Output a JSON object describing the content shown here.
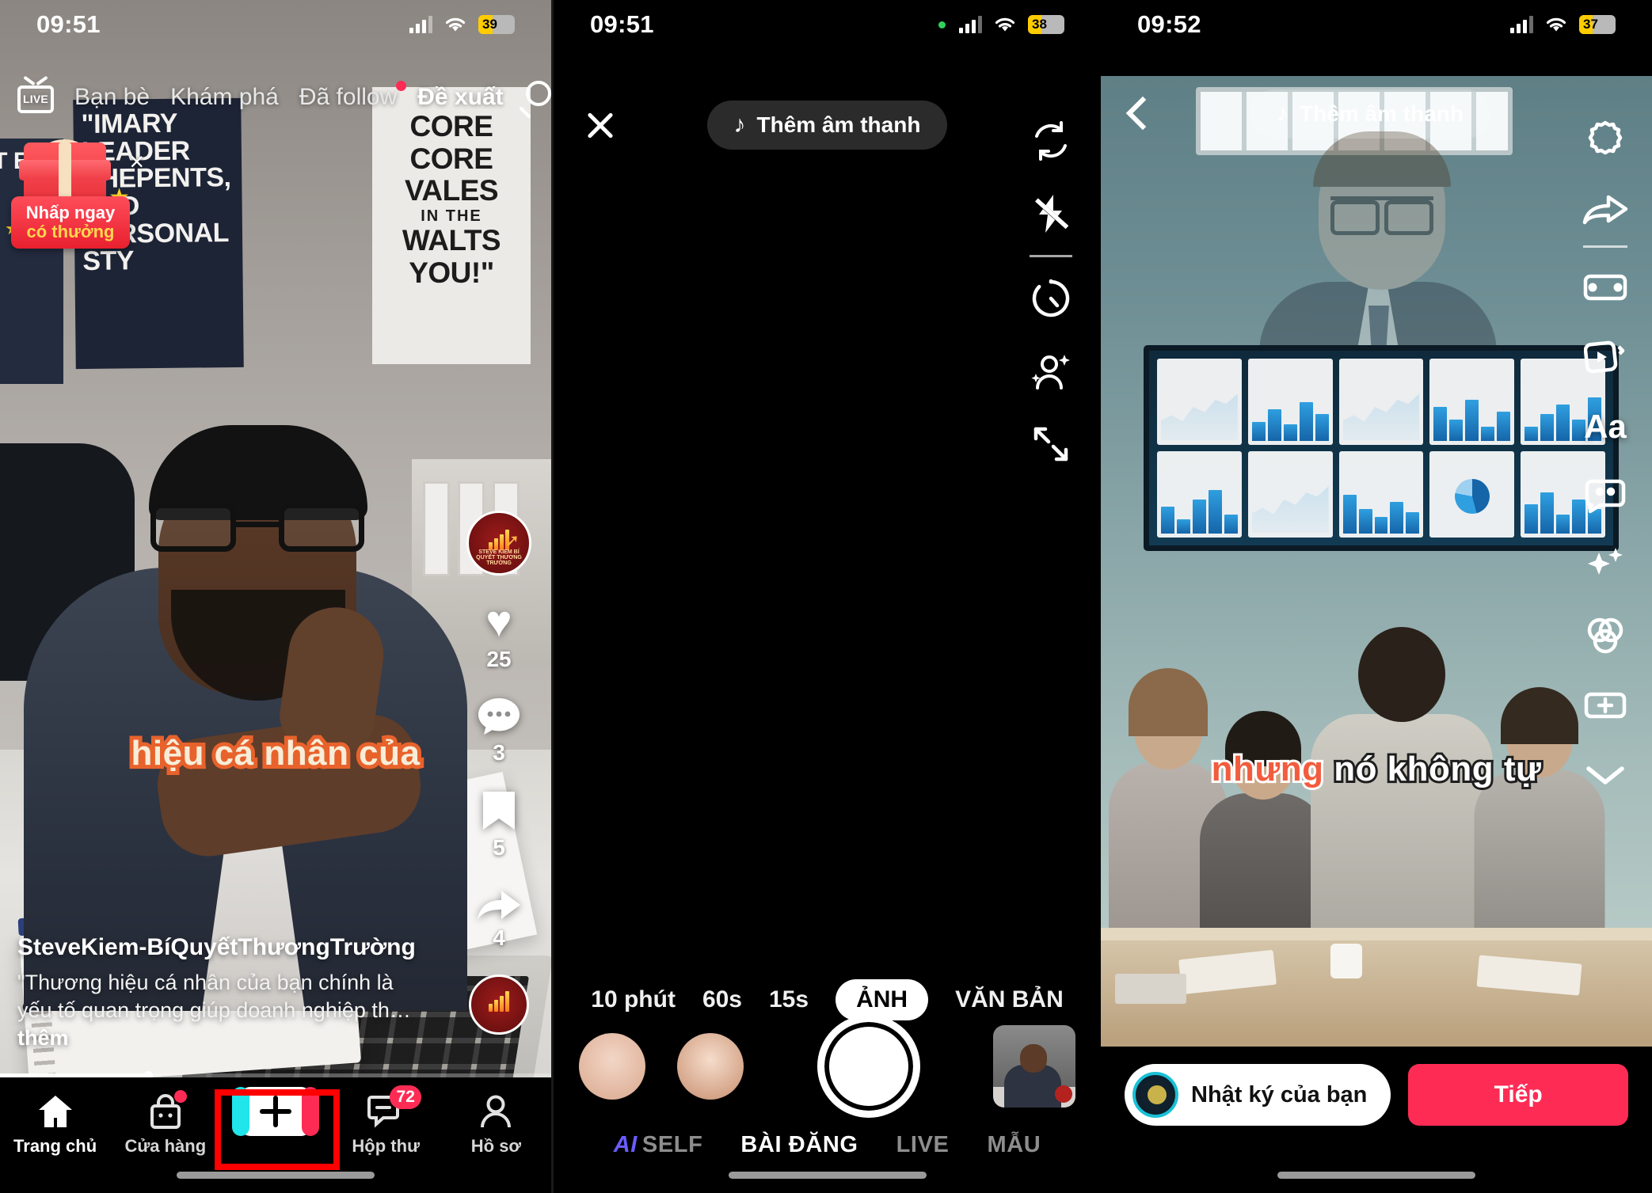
{
  "panels": {
    "feed": {
      "status": {
        "time": "09:51",
        "battery": "39",
        "battery_pct": 39
      },
      "topnav": {
        "live_label": "LIVE",
        "items": [
          {
            "label": "Bạn bè",
            "active": false,
            "dot": false
          },
          {
            "label": "Khám phá",
            "active": false,
            "dot": false
          },
          {
            "label": "Đã follow",
            "active": false,
            "dot": true
          },
          {
            "label": "Đề xuất",
            "active": true,
            "dot": false
          }
        ],
        "search_icon": "search-icon"
      },
      "promo": {
        "line1": "Nhấp ngay",
        "line2": "có thưởng",
        "close": "×"
      },
      "posters": {
        "dark": "\"IMARY LEADER SHEPENTS, AND PERSONAL STY",
        "dark_left": "RT E",
        "light_line1": "CORE",
        "light_line2": "CORE",
        "light_line3": "VALES",
        "light_small": "IN THE",
        "light_line4": "WALTS",
        "light_line5": "YOU!\""
      },
      "subtitle": "hiệu cá nhân của",
      "rail": {
        "like_count": "25",
        "comment_count": "3",
        "bookmark_count": "5",
        "share_count": "4",
        "avatar_name": "STEVE KIEM BÍ QUYẾT THƯƠNG TRƯỜNG"
      },
      "caption": {
        "username": "SteveKiem-BíQuyếtThươngTrường",
        "description": "\"Thương hiệu cá nhân của bạn chính là yếu tố quan trọng giúp doanh nghiệp th…",
        "more": "thêm"
      },
      "tabbar": [
        {
          "label": "Trang chủ",
          "icon": "home-icon",
          "active": true,
          "badge": ""
        },
        {
          "label": "Cửa hàng",
          "icon": "shop-icon",
          "active": false,
          "badge": ""
        },
        {
          "label": "",
          "icon": "create-plus-icon",
          "active": false,
          "badge": ""
        },
        {
          "label": "Hộp thư",
          "icon": "inbox-icon",
          "active": false,
          "badge": "72"
        },
        {
          "label": "Hồ sơ",
          "icon": "profile-icon",
          "active": false,
          "badge": ""
        }
      ]
    },
    "camera": {
      "status": {
        "time": "09:51",
        "battery": "38",
        "battery_pct": 38
      },
      "close_label": "×",
      "sound_button": "Thêm âm thanh",
      "rail_icons": [
        "flip-camera-icon",
        "flash-off-icon",
        "timer-icon",
        "beautify-icon",
        "expand-icon"
      ],
      "modes": [
        {
          "label": "10 phút",
          "selected": false
        },
        {
          "label": "60s",
          "selected": false
        },
        {
          "label": "15s",
          "selected": false
        },
        {
          "label": "ẢNH",
          "selected": true
        },
        {
          "label": "VĂN BẢN",
          "selected": false
        }
      ],
      "shutter": "shutter-button",
      "gallery_thumb": "gallery-thumbnail",
      "tabs": [
        {
          "label": "SELF",
          "prefix": "AI",
          "active": false
        },
        {
          "label": "BÀI ĐĂNG",
          "prefix": "",
          "active": true
        },
        {
          "label": "LIVE",
          "prefix": "",
          "active": false
        },
        {
          "label": "MẪU",
          "prefix": "",
          "active": false
        }
      ]
    },
    "editor": {
      "status": {
        "time": "09:52",
        "battery": "37",
        "battery_pct": 37
      },
      "sound_button": "Thêm âm thanh",
      "back_icon": "back-chevron-icon",
      "rail_icons": [
        "settings-gear-icon",
        "share-arrow-icon",
        "trim-clip-icon",
        "video-overlay-icon",
        "text-icon",
        "sticker-icon",
        "effects-sparkle-icon",
        "filter-icon",
        "add-icon",
        "collapse-chevron-icon"
      ],
      "text_icon_label": "Aa",
      "subtitle": {
        "highlight": "nhưng",
        "rest": " nó không tự"
      },
      "diary_button": "Nhật ký của bạn",
      "next_button": "Tiếp"
    }
  },
  "annotations": {
    "boxes": [
      {
        "name": "create-button-highlight"
      },
      {
        "name": "gallery-thumb-highlight"
      },
      {
        "name": "next-button-highlight"
      }
    ],
    "color": "#ff0000"
  }
}
